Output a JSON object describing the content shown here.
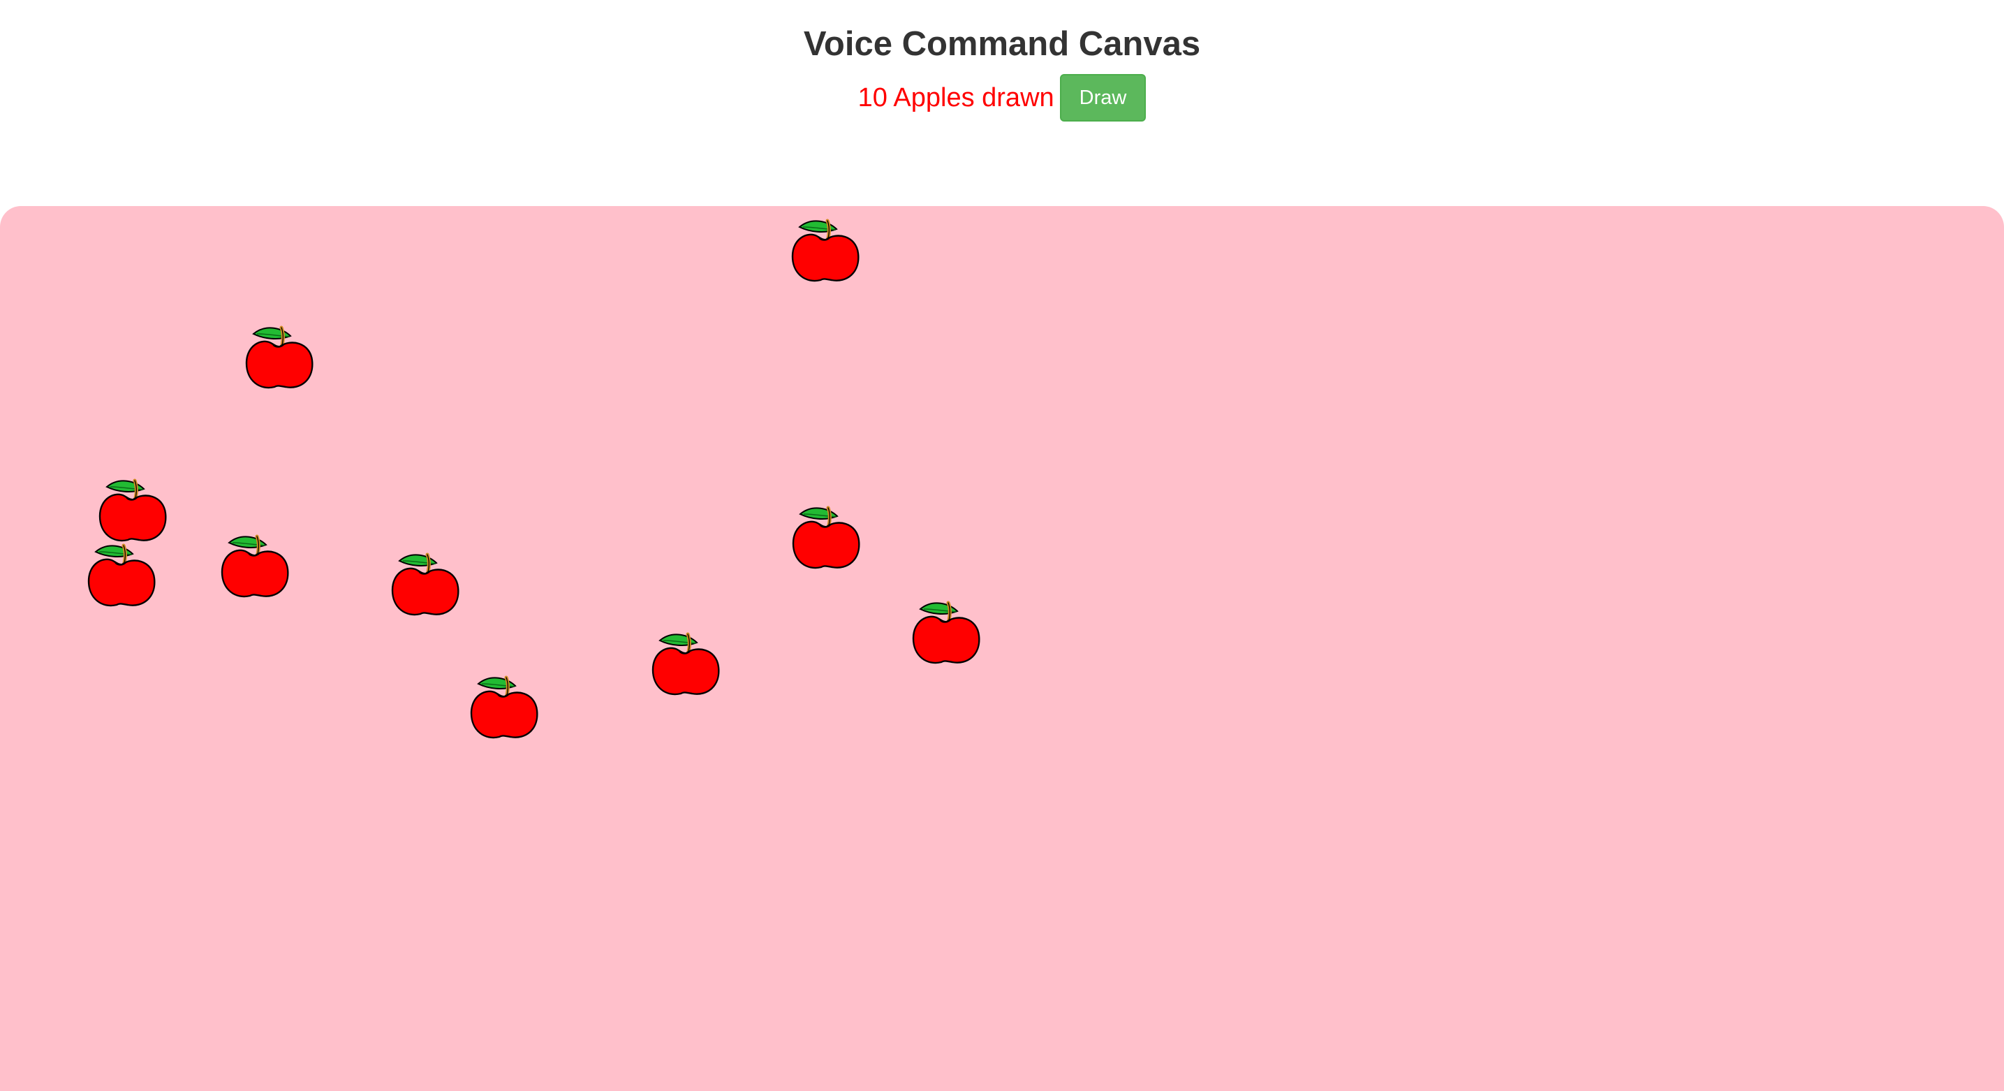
{
  "header": {
    "title": "Voice Command Canvas",
    "status": "10 Apples drawn",
    "draw_button_label": "Draw"
  },
  "canvas": {
    "background_color": "#ffc0cb",
    "apple_count": 10,
    "apple_icon": "apple-icon"
  },
  "colors": {
    "title": "#333333",
    "status": "#ff0000",
    "button": "#5cb85c",
    "apple": "#ff0000",
    "leaf": "#22bb33"
  }
}
